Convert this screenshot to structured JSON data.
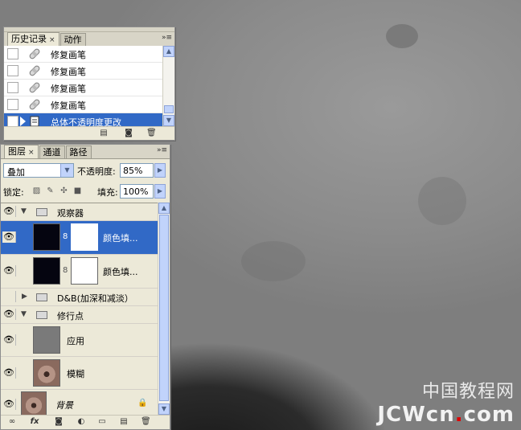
{
  "history_panel": {
    "tabs": [
      {
        "label": "历史记录",
        "close": "×"
      },
      {
        "label": "动作"
      }
    ],
    "menu_icon": "»≡",
    "rows": [
      {
        "label": "修复画笔",
        "icon": "healing-brush-icon"
      },
      {
        "label": "修复画笔",
        "icon": "healing-brush-icon"
      },
      {
        "label": "修复画笔",
        "icon": "healing-brush-icon"
      },
      {
        "label": "修复画笔",
        "icon": "healing-brush-icon"
      },
      {
        "label": "总体不透明度更改",
        "icon": "history-state-icon",
        "selected": true
      }
    ]
  },
  "layers_panel": {
    "tabs": [
      {
        "label": "图层",
        "close": "×"
      },
      {
        "label": "通道"
      },
      {
        "label": "路径"
      }
    ],
    "menu_icon": "»≡",
    "blend_mode": "叠加",
    "opacity_label": "不透明度:",
    "opacity_value": "85%",
    "lock_label": "锁定:",
    "fill_label": "填充:",
    "fill_value": "100%",
    "layers": [
      {
        "label": "观察器",
        "type": "group"
      },
      {
        "label": "颜色填...",
        "type": "fill",
        "selected": true
      },
      {
        "label": "颜色填...",
        "type": "fill"
      },
      {
        "label": "D&B(加深和减淡）",
        "type": "group-collapsed"
      },
      {
        "label": "修行点",
        "type": "group"
      },
      {
        "label": "应用",
        "type": "layer"
      },
      {
        "label": "模糊",
        "type": "layer"
      },
      {
        "label": "背景",
        "type": "background"
      }
    ]
  },
  "watermark": {
    "cn": "中国教程网",
    "en_a": "JCWcn",
    "en_dot": ".",
    "en_b": "com"
  },
  "colors": {
    "selection": "#3169c6",
    "panel_bg": "#ece9d8"
  }
}
